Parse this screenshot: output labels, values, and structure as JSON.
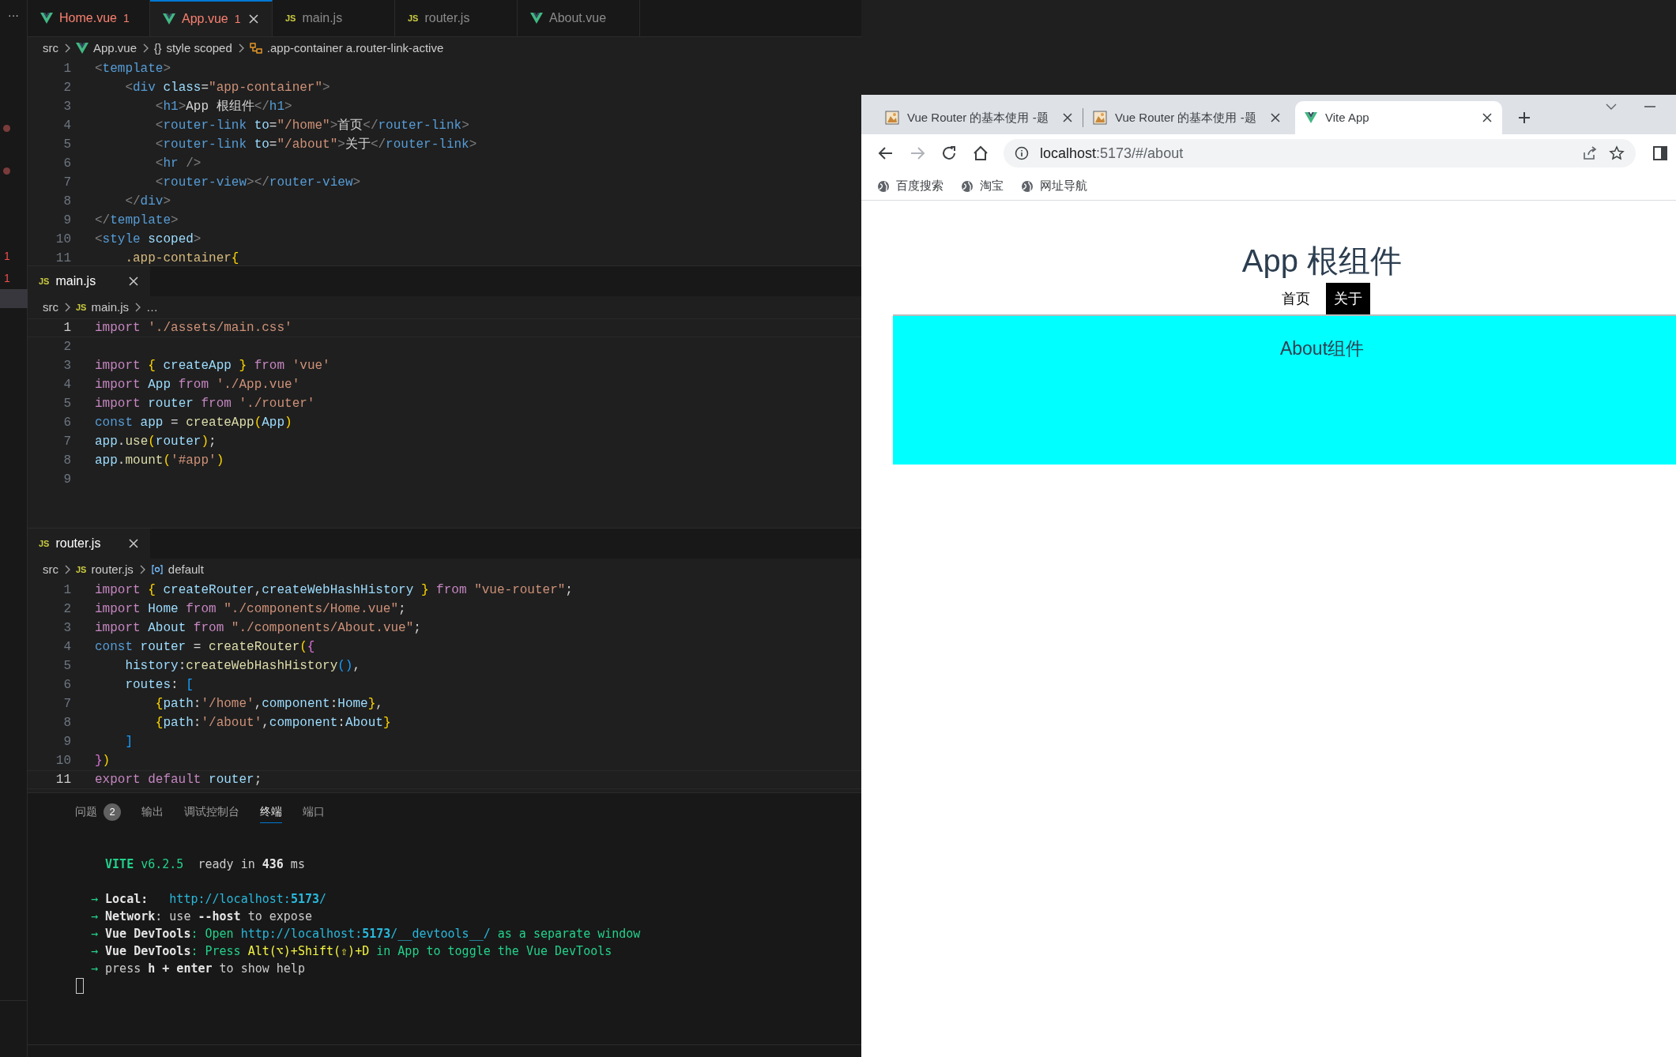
{
  "gutter": {
    "menu": "···",
    "markers": [
      "1",
      "1"
    ]
  },
  "editor_tabs": [
    {
      "label": "Home.vue",
      "kind": "vue",
      "problems": "1",
      "selected": false
    },
    {
      "label": "App.vue",
      "kind": "vue",
      "problems": "1",
      "selected": true
    },
    {
      "label": "main.js",
      "kind": "js",
      "icon_text": "JS",
      "selected": false
    },
    {
      "label": "router.js",
      "kind": "js",
      "icon_text": "JS",
      "selected": false
    },
    {
      "label": "About.vue",
      "kind": "vue",
      "selected": false
    }
  ],
  "editors": [
    {
      "breadcrumb": [
        {
          "text": "src"
        },
        {
          "text": "App.vue",
          "kind": "vue"
        },
        {
          "text": "style scoped",
          "kind": "braces",
          "icon_text": "{}"
        },
        {
          "text": ".app-container a.router-link-active",
          "kind": "selector"
        }
      ],
      "lines": [
        {
          "number": "1",
          "tokens": [
            {
              "text": "<",
              "kind": "punct"
            },
            {
              "text": "template",
              "kind": "tag"
            },
            {
              "text": ">",
              "kind": "punct"
            }
          ]
        },
        {
          "number": "2",
          "tokens": [
            {
              "text": "    <",
              "kind": "punct"
            },
            {
              "text": "div",
              "kind": "tag"
            },
            {
              "text": " class",
              "kind": "attr"
            },
            {
              "text": "=",
              "kind": "text"
            },
            {
              "text": "\"app-container\"",
              "kind": "string"
            },
            {
              "text": ">",
              "kind": "punct"
            }
          ]
        },
        {
          "number": "3",
          "tokens": [
            {
              "text": "        <",
              "kind": "punct"
            },
            {
              "text": "h1",
              "kind": "tag"
            },
            {
              "text": ">",
              "kind": "punct"
            },
            {
              "text": "App 根组件",
              "kind": "text"
            },
            {
              "text": "</",
              "kind": "punct"
            },
            {
              "text": "h1",
              "kind": "tag"
            },
            {
              "text": ">",
              "kind": "punct"
            }
          ]
        },
        {
          "number": "4",
          "tokens": [
            {
              "text": "        <",
              "kind": "punct"
            },
            {
              "text": "router-link",
              "kind": "tag"
            },
            {
              "text": " to",
              "kind": "attr"
            },
            {
              "text": "=",
              "kind": "text"
            },
            {
              "text": "\"/home\"",
              "kind": "string"
            },
            {
              "text": ">",
              "kind": "punct"
            },
            {
              "text": "首页",
              "kind": "text"
            },
            {
              "text": "</",
              "kind": "punct"
            },
            {
              "text": "router-link",
              "kind": "tag"
            },
            {
              "text": ">",
              "kind": "punct"
            }
          ]
        },
        {
          "number": "5",
          "tokens": [
            {
              "text": "        <",
              "kind": "punct"
            },
            {
              "text": "router-link",
              "kind": "tag"
            },
            {
              "text": " to",
              "kind": "attr"
            },
            {
              "text": "=",
              "kind": "text"
            },
            {
              "text": "\"/about\"",
              "kind": "string"
            },
            {
              "text": ">",
              "kind": "punct"
            },
            {
              "text": "关于",
              "kind": "text"
            },
            {
              "text": "</",
              "kind": "punct"
            },
            {
              "text": "router-link",
              "kind": "tag"
            },
            {
              "text": ">",
              "kind": "punct"
            }
          ]
        },
        {
          "number": "6",
          "tokens": [
            {
              "text": "        <",
              "kind": "punct"
            },
            {
              "text": "hr",
              "kind": "tag"
            },
            {
              "text": " />",
              "kind": "punct"
            }
          ]
        },
        {
          "number": "7",
          "tokens": [
            {
              "text": "        <",
              "kind": "punct"
            },
            {
              "text": "router-view",
              "kind": "tag"
            },
            {
              "text": "></",
              "kind": "punct"
            },
            {
              "text": "router-view",
              "kind": "tag"
            },
            {
              "text": ">",
              "kind": "punct"
            }
          ]
        },
        {
          "number": "8",
          "tokens": [
            {
              "text": "    </",
              "kind": "punct"
            },
            {
              "text": "div",
              "kind": "tag"
            },
            {
              "text": ">",
              "kind": "punct"
            }
          ]
        },
        {
          "number": "9",
          "tokens": [
            {
              "text": "</",
              "kind": "punct"
            },
            {
              "text": "template",
              "kind": "tag"
            },
            {
              "text": ">",
              "kind": "punct"
            }
          ]
        },
        {
          "number": "10",
          "tokens": [
            {
              "text": "<",
              "kind": "punct"
            },
            {
              "text": "style",
              "kind": "tag"
            },
            {
              "text": " scoped",
              "kind": "attr"
            },
            {
              "text": ">",
              "kind": "punct"
            }
          ]
        },
        {
          "number": "11",
          "tokens": [
            {
              "text": "    .app-container",
              "kind": "selector"
            },
            {
              "text": "{",
              "kind": "b1"
            }
          ]
        }
      ]
    },
    {
      "header": {
        "label": "main.js",
        "kind": "js",
        "icon_text": "JS"
      },
      "breadcrumb": [
        {
          "text": "src"
        },
        {
          "text": "main.js",
          "kind": "js",
          "icon_text": "JS"
        },
        {
          "text": "…"
        }
      ],
      "lines": [
        {
          "number": "1",
          "current": true,
          "tokens": [
            {
              "text": "import ",
              "kind": "keyword"
            },
            {
              "text": "'./assets/main.css'",
              "kind": "string"
            }
          ]
        },
        {
          "number": "2",
          "current": false
        },
        {
          "number": "3",
          "current": false,
          "tokens": [
            {
              "text": "import ",
              "kind": "keyword"
            },
            {
              "text": "{",
              "kind": "b1"
            },
            {
              "text": " createApp ",
              "kind": "var"
            },
            {
              "text": "}",
              "kind": "b1"
            },
            {
              "text": " from ",
              "kind": "keyword"
            },
            {
              "text": "'vue'",
              "kind": "string"
            }
          ]
        },
        {
          "number": "4",
          "current": false,
          "tokens": [
            {
              "text": "import ",
              "kind": "keyword"
            },
            {
              "text": "App",
              "kind": "var"
            },
            {
              "text": " from ",
              "kind": "keyword"
            },
            {
              "text": "'./App.vue'",
              "kind": "string"
            }
          ]
        },
        {
          "number": "5",
          "current": false,
          "tokens": [
            {
              "text": "import ",
              "kind": "keyword"
            },
            {
              "text": "router",
              "kind": "var"
            },
            {
              "text": " from ",
              "kind": "keyword"
            },
            {
              "text": "'./router'",
              "kind": "string"
            }
          ]
        },
        {
          "number": "6",
          "current": false,
          "tokens": [
            {
              "text": "const ",
              "kind": "storage"
            },
            {
              "text": "app",
              "kind": "var"
            },
            {
              "text": " = ",
              "kind": "text"
            },
            {
              "text": "createApp",
              "kind": "func"
            },
            {
              "text": "(",
              "kind": "b1"
            },
            {
              "text": "App",
              "kind": "var"
            },
            {
              "text": ")",
              "kind": "b1"
            }
          ]
        },
        {
          "number": "7",
          "current": false,
          "tokens": [
            {
              "text": "app",
              "kind": "var"
            },
            {
              "text": ".",
              "kind": "text"
            },
            {
              "text": "use",
              "kind": "func"
            },
            {
              "text": "(",
              "kind": "b1"
            },
            {
              "text": "router",
              "kind": "var"
            },
            {
              "text": ")",
              "kind": "b1"
            },
            {
              "text": ";",
              "kind": "text"
            }
          ]
        },
        {
          "number": "8",
          "current": false,
          "tokens": [
            {
              "text": "app",
              "kind": "var"
            },
            {
              "text": ".",
              "kind": "text"
            },
            {
              "text": "mount",
              "kind": "func"
            },
            {
              "text": "(",
              "kind": "b1"
            },
            {
              "text": "'#app'",
              "kind": "string"
            },
            {
              "text": ")",
              "kind": "b1"
            }
          ]
        },
        {
          "number": "9",
          "current": false
        }
      ]
    },
    {
      "header": {
        "label": "router.js",
        "kind": "js",
        "icon_text": "JS"
      },
      "breadcrumb": [
        {
          "text": "src"
        },
        {
          "text": "router.js",
          "kind": "js",
          "icon_text": "JS"
        },
        {
          "text": "default",
          "kind": "symbol"
        }
      ],
      "lines": [
        {
          "number": "1",
          "current": false,
          "tokens": [
            {
              "text": "import ",
              "kind": "keyword"
            },
            {
              "text": "{",
              "kind": "b1"
            },
            {
              "text": " createRouter",
              "kind": "var"
            },
            {
              "text": ",",
              "kind": "text"
            },
            {
              "text": "createWebHashHistory ",
              "kind": "var"
            },
            {
              "text": "}",
              "kind": "b1"
            },
            {
              "text": " from ",
              "kind": "keyword"
            },
            {
              "text": "\"vue-router\"",
              "kind": "string"
            },
            {
              "text": ";",
              "kind": "text"
            }
          ]
        },
        {
          "number": "2",
          "current": false,
          "tokens": [
            {
              "text": "import ",
              "kind": "keyword"
            },
            {
              "text": "Home",
              "kind": "var"
            },
            {
              "text": " from ",
              "kind": "keyword"
            },
            {
              "text": "\"./components/Home.vue\"",
              "kind": "string"
            },
            {
              "text": ";",
              "kind": "text"
            }
          ]
        },
        {
          "number": "3",
          "current": false,
          "tokens": [
            {
              "text": "import ",
              "kind": "keyword"
            },
            {
              "text": "About",
              "kind": "var"
            },
            {
              "text": " from ",
              "kind": "keyword"
            },
            {
              "text": "\"./components/About.vue\"",
              "kind": "string"
            },
            {
              "text": ";",
              "kind": "text"
            }
          ]
        },
        {
          "number": "4",
          "current": false,
          "tokens": [
            {
              "text": "const ",
              "kind": "storage"
            },
            {
              "text": "router",
              "kind": "var"
            },
            {
              "text": " = ",
              "kind": "text"
            },
            {
              "text": "createRouter",
              "kind": "func"
            },
            {
              "text": "(",
              "kind": "b1"
            },
            {
              "text": "{",
              "kind": "b2"
            }
          ]
        },
        {
          "number": "5",
          "current": false,
          "tokens": [
            {
              "text": "    history",
              "kind": "var"
            },
            {
              "text": ":",
              "kind": "text"
            },
            {
              "text": "createWebHashHistory",
              "kind": "func"
            },
            {
              "text": "()",
              "kind": "b3"
            },
            {
              "text": ",",
              "kind": "text"
            }
          ]
        },
        {
          "number": "6",
          "current": false,
          "tokens": [
            {
              "text": "    routes",
              "kind": "var"
            },
            {
              "text": ": ",
              "kind": "text"
            },
            {
              "text": "[",
              "kind": "b3"
            }
          ]
        },
        {
          "number": "7",
          "current": false,
          "tokens": [
            {
              "text": "        {",
              "kind": "b1"
            },
            {
              "text": "path",
              "kind": "var"
            },
            {
              "text": ":",
              "kind": "text"
            },
            {
              "text": "'/home'",
              "kind": "string"
            },
            {
              "text": ",",
              "kind": "text"
            },
            {
              "text": "component",
              "kind": "var"
            },
            {
              "text": ":",
              "kind": "text"
            },
            {
              "text": "Home",
              "kind": "var"
            },
            {
              "text": "}",
              "kind": "b1"
            },
            {
              "text": ",",
              "kind": "text"
            }
          ]
        },
        {
          "number": "8",
          "current": false,
          "tokens": [
            {
              "text": "        {",
              "kind": "b1"
            },
            {
              "text": "path",
              "kind": "var"
            },
            {
              "text": ":",
              "kind": "text"
            },
            {
              "text": "'/about'",
              "kind": "string"
            },
            {
              "text": ",",
              "kind": "text"
            },
            {
              "text": "component",
              "kind": "var"
            },
            {
              "text": ":",
              "kind": "text"
            },
            {
              "text": "About",
              "kind": "var"
            },
            {
              "text": "}",
              "kind": "b1"
            }
          ]
        },
        {
          "number": "9",
          "current": false,
          "tokens": [
            {
              "text": "    ]",
              "kind": "b3"
            }
          ]
        },
        {
          "number": "10",
          "current": false,
          "tokens": [
            {
              "text": "}",
              "kind": "b2"
            },
            {
              "text": ")",
              "kind": "b1"
            }
          ]
        },
        {
          "number": "11",
          "current": true,
          "tokens": [
            {
              "text": "export default ",
              "kind": "keyword"
            },
            {
              "text": "router",
              "kind": "var"
            },
            {
              "text": ";",
              "kind": "text"
            }
          ]
        }
      ]
    }
  ],
  "panel_tabs": [
    {
      "label": "问题",
      "badge": "2",
      "selected": false
    },
    {
      "label": "输出",
      "selected": false
    },
    {
      "label": "调试控制台",
      "selected": false
    },
    {
      "label": "终端",
      "selected": true
    },
    {
      "label": "端口",
      "selected": false
    }
  ],
  "terminal": [
    {
      "tokens": [
        {
          "text": "  VITE",
          "kind": "greenbold"
        },
        {
          "text": " v6.2.5",
          "kind": "green"
        },
        {
          "text": "  ready in ",
          "kind": "plain"
        },
        {
          "text": "436",
          "kind": "bold"
        },
        {
          "text": " ms",
          "kind": "plain"
        }
      ]
    },
    {
      "tokens": [
        {
          "text": "→ ",
          "kind": "green"
        },
        {
          "text": "Local:",
          "kind": "bold"
        },
        {
          "text": "   http://localhost:",
          "kind": "cyan"
        },
        {
          "text": "5173",
          "kind": "cyanbold"
        },
        {
          "text": "/",
          "kind": "cyan"
        }
      ]
    },
    {
      "tokens": [
        {
          "text": "→ ",
          "kind": "green"
        },
        {
          "text": "Network",
          "kind": "bold"
        },
        {
          "text": ": use ",
          "kind": "plain"
        },
        {
          "text": "--host",
          "kind": "bold"
        },
        {
          "text": " to expose",
          "kind": "plain"
        }
      ]
    },
    {
      "tokens": [
        {
          "text": "→ ",
          "kind": "green"
        },
        {
          "text": "Vue DevTools",
          "kind": "bold"
        },
        {
          "text": ": Open ",
          "kind": "green"
        },
        {
          "text": "http://localhost:",
          "kind": "cyan"
        },
        {
          "text": "5173",
          "kind": "cyanbold"
        },
        {
          "text": "/__devtools__/",
          "kind": "cyan"
        },
        {
          "text": " as a separate window",
          "kind": "green"
        }
      ]
    },
    {
      "tokens": [
        {
          "text": "→ ",
          "kind": "green"
        },
        {
          "text": "Vue DevTools",
          "kind": "bold"
        },
        {
          "text": ": Press ",
          "kind": "green"
        },
        {
          "text": "Alt(⌥)+Shift(⇧)+D",
          "kind": "yellow"
        },
        {
          "text": " in App to toggle the Vue DevTools",
          "kind": "green"
        }
      ]
    },
    {
      "tokens": [
        {
          "text": "→ ",
          "kind": "green"
        },
        {
          "text": "press ",
          "kind": "plain"
        },
        {
          "text": "h + enter",
          "kind": "bold"
        },
        {
          "text": " to show help",
          "kind": "plain"
        }
      ]
    }
  ],
  "browser": {
    "tabs": [
      {
        "title": "Vue Router 的基本使用 -题",
        "kind": "image",
        "selected": false
      },
      {
        "title": "Vue Router 的基本使用 -题",
        "kind": "image",
        "selected": false
      },
      {
        "title": "Vite App",
        "kind": "vue",
        "selected": true
      }
    ],
    "address": {
      "host": "localhost",
      "path": ":5173/#/about"
    },
    "bookmarks": [
      "百度搜索",
      "淘宝",
      "网址导航"
    ],
    "page": {
      "heading": "App 根组件",
      "links": [
        {
          "label": "首页",
          "selected": false
        },
        {
          "label": "关于",
          "selected": true
        }
      ],
      "view_text": "About组件"
    }
  }
}
